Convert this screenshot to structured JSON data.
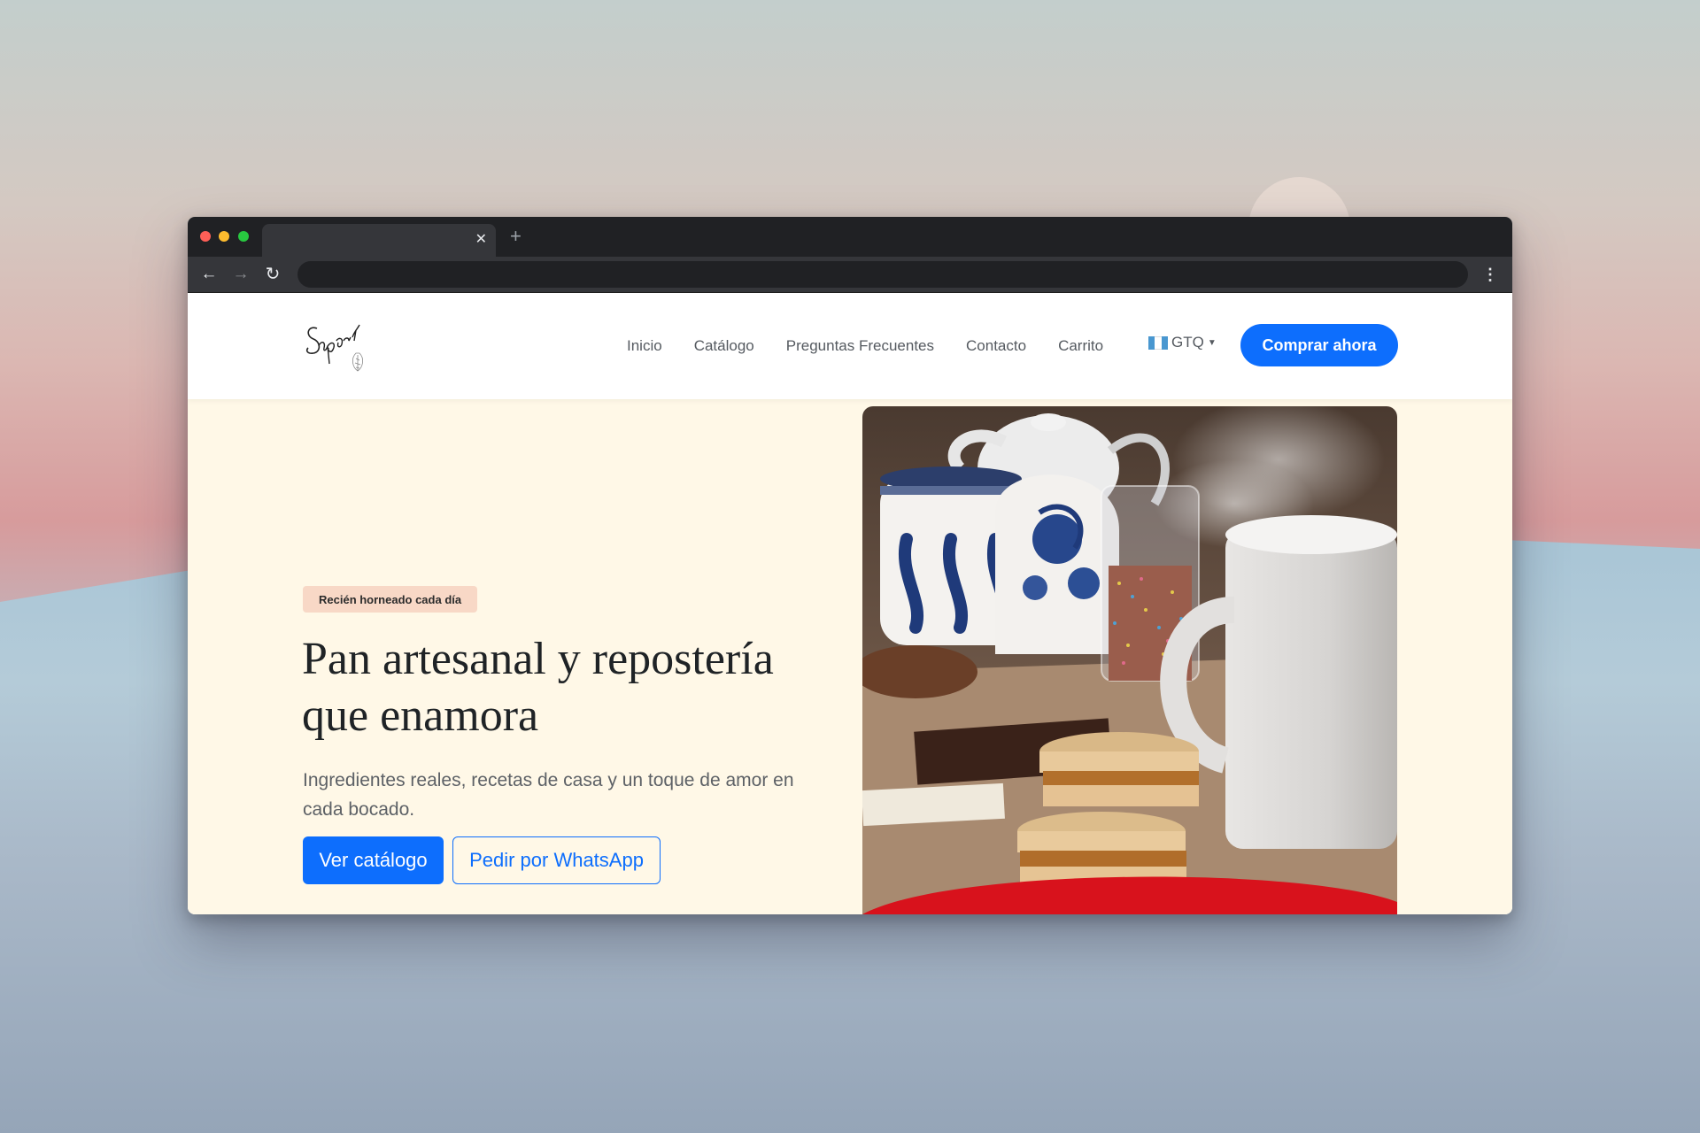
{
  "browser": {
    "tab_close_glyph": "✕",
    "new_tab_glyph": "+",
    "back_glyph": "←",
    "forward_glyph": "→",
    "reload_glyph": "↻",
    "menu_glyph": "⋮"
  },
  "nav": {
    "logo_icon": "sapori-logo-icon",
    "links": [
      "Inicio",
      "Catálogo",
      "Preguntas Frecuentes",
      "Contacto",
      "Carrito"
    ],
    "currency": "GTQ",
    "currency_flag_icon": "guatemala-flag-icon",
    "buy_button": "Comprar ahora"
  },
  "hero": {
    "badge": "Recién horneado cada día",
    "title": "Pan artesanal y repostería que enamora",
    "subtitle": "Ingredientes reales, recetas de casa y un toque de amor en cada bocado.",
    "primary_button": "Ver catálogo",
    "secondary_button": "Pedir por WhatsApp",
    "image_icon": "alfajores-and-coffee-photo"
  },
  "colors": {
    "accent": "#0d6efd",
    "hero_background": "#fff8e7",
    "badge_background": "#f8d8c6",
    "browser_chrome": "#202124"
  }
}
